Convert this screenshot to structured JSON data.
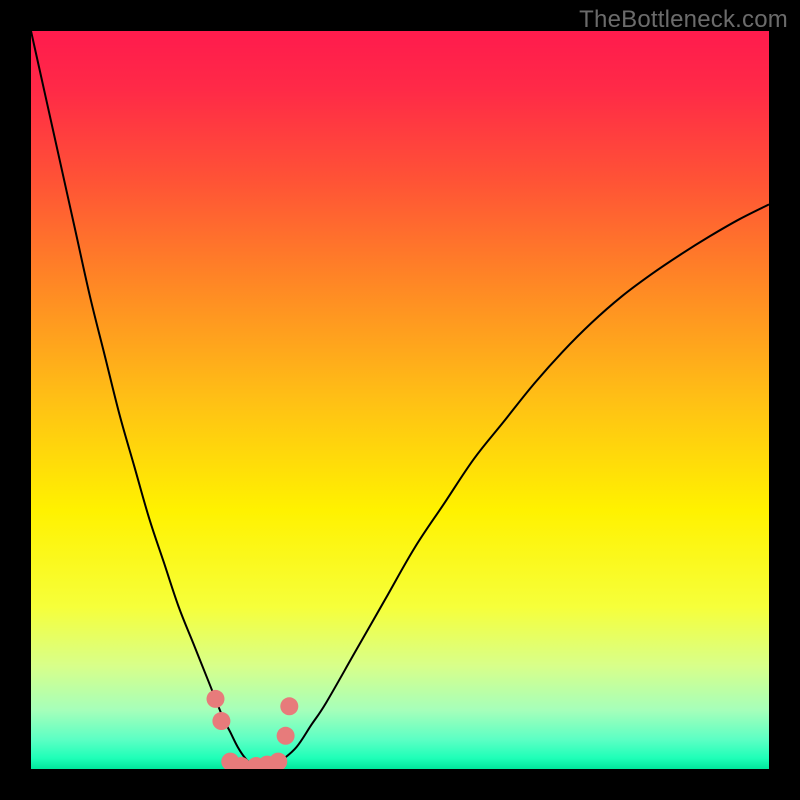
{
  "watermark": {
    "text": "TheBottleneck.com"
  },
  "chart_data": {
    "type": "line",
    "title": "",
    "xlabel": "",
    "ylabel": "",
    "xlim": [
      0,
      100
    ],
    "ylim": [
      0,
      100
    ],
    "grid": false,
    "legend": false,
    "background_gradient": {
      "stops": [
        {
          "offset": 0.0,
          "color": "#ff1b4d"
        },
        {
          "offset": 0.08,
          "color": "#ff2a47"
        },
        {
          "offset": 0.2,
          "color": "#ff5236"
        },
        {
          "offset": 0.35,
          "color": "#ff8a24"
        },
        {
          "offset": 0.5,
          "color": "#ffc015"
        },
        {
          "offset": 0.65,
          "color": "#fff200"
        },
        {
          "offset": 0.78,
          "color": "#f6ff3a"
        },
        {
          "offset": 0.86,
          "color": "#d8ff8a"
        },
        {
          "offset": 0.92,
          "color": "#a6ffba"
        },
        {
          "offset": 0.96,
          "color": "#5cffc4"
        },
        {
          "offset": 0.985,
          "color": "#1fffb8"
        },
        {
          "offset": 1.0,
          "color": "#00e79b"
        }
      ]
    },
    "series": [
      {
        "name": "curve",
        "color": "#000000",
        "stroke_width": 2,
        "x": [
          0,
          2,
          4,
          6,
          8,
          10,
          12,
          14,
          16,
          18,
          20,
          22,
          24,
          26,
          27,
          28,
          29,
          30,
          31,
          32,
          33,
          34,
          36,
          38,
          40,
          44,
          48,
          52,
          56,
          60,
          64,
          68,
          72,
          76,
          80,
          84,
          88,
          92,
          96,
          100
        ],
        "y": [
          100,
          91,
          82,
          73,
          64,
          56,
          48,
          41,
          34,
          28,
          22,
          17,
          12,
          7,
          5,
          3,
          1.5,
          0.5,
          0.3,
          0.3,
          0.5,
          1.2,
          3,
          6,
          9,
          16,
          23,
          30,
          36,
          42,
          47,
          52,
          56.5,
          60.5,
          64,
          67,
          69.7,
          72.2,
          74.5,
          76.5
        ]
      }
    ],
    "markers": {
      "name": "trough-markers",
      "color": "#e77b7b",
      "radius": 9,
      "points": [
        {
          "x": 25.0,
          "y": 9.5
        },
        {
          "x": 25.8,
          "y": 6.5
        },
        {
          "x": 27.0,
          "y": 1.0
        },
        {
          "x": 28.5,
          "y": 0.4
        },
        {
          "x": 30.5,
          "y": 0.4
        },
        {
          "x": 32.0,
          "y": 0.6
        },
        {
          "x": 33.5,
          "y": 1.0
        },
        {
          "x": 34.5,
          "y": 4.5
        },
        {
          "x": 35.0,
          "y": 8.5
        }
      ]
    }
  }
}
